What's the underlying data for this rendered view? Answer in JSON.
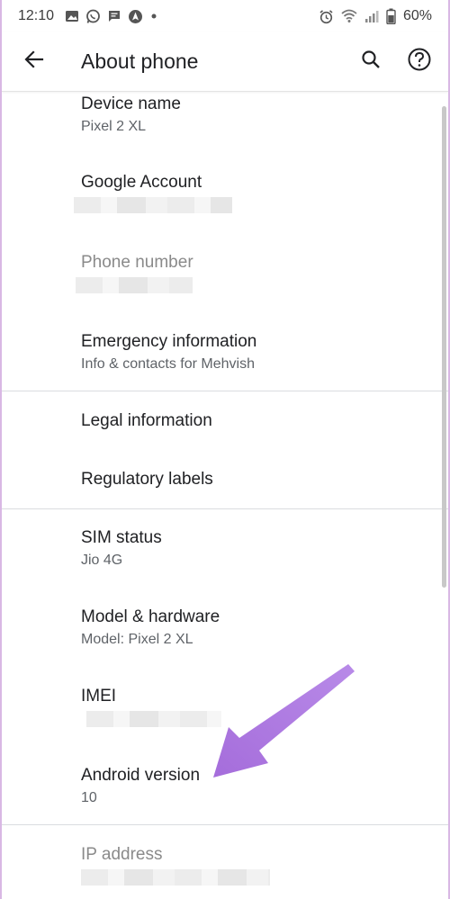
{
  "status_bar": {
    "time": "12:10",
    "battery": "60%",
    "icons_left": [
      "image-icon",
      "whatsapp-icon",
      "message-icon",
      "navigation-icon",
      "dot-icon"
    ],
    "icons_right": [
      "alarm-icon",
      "wifi-icon",
      "signal-icon",
      "battery-icon"
    ]
  },
  "app_bar": {
    "title": "About phone",
    "icons": [
      "back-arrow-icon",
      "search-icon",
      "help-icon"
    ]
  },
  "items": [
    {
      "title": "Device name",
      "subtitle": "Pixel 2 XL"
    },
    {
      "title": "Google Account",
      "subtitle": ""
    },
    {
      "title": "Phone number",
      "subtitle": ""
    },
    {
      "title": "Emergency information",
      "subtitle": "Info & contacts for Mehvish"
    },
    {
      "title": "Legal information"
    },
    {
      "title": "Regulatory labels"
    },
    {
      "title": "SIM status",
      "subtitle": "Jio 4G"
    },
    {
      "title": "Model & hardware",
      "subtitle": "Model: Pixel 2 XL"
    },
    {
      "title": "IMEI",
      "subtitle": ""
    },
    {
      "title": "Android version",
      "subtitle": "10"
    },
    {
      "title": "IP address",
      "subtitle": ""
    }
  ],
  "colors": {
    "accent_arrow": "#b57fe6",
    "frame_border": "#d9b8e4",
    "divider": "#dadce0"
  }
}
